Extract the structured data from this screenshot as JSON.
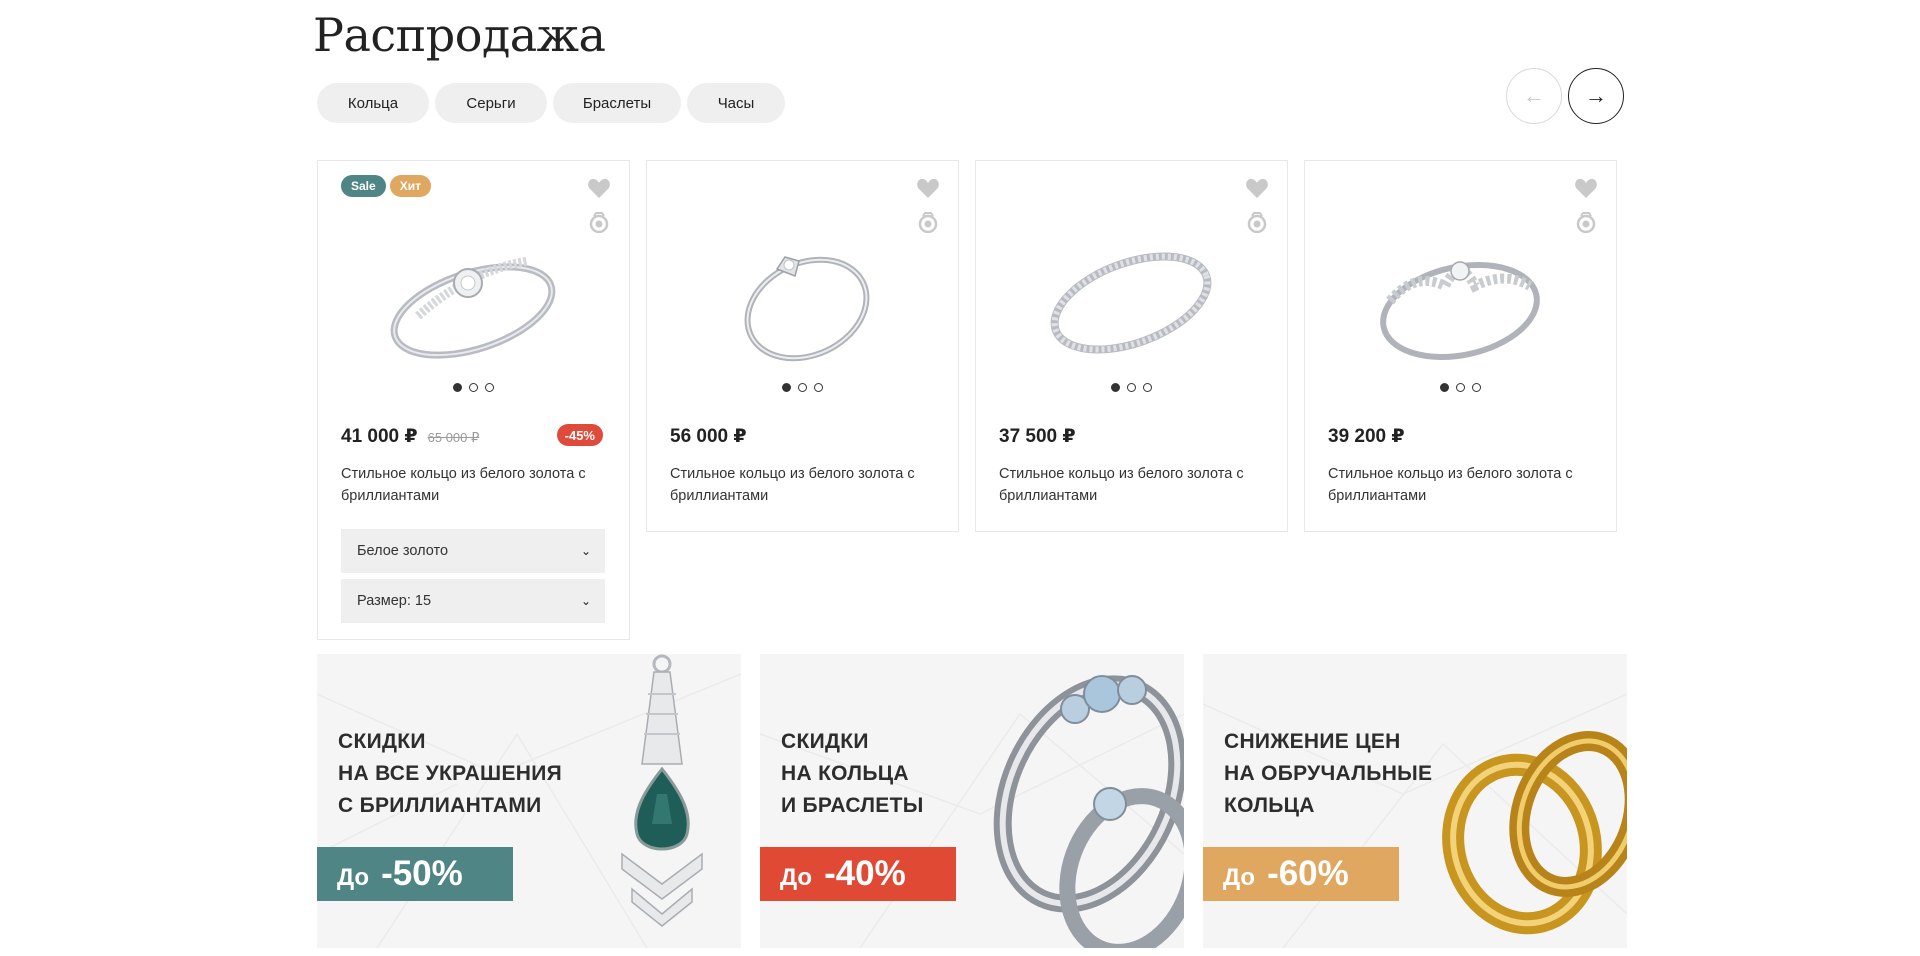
{
  "page": {
    "title": "Распродажа"
  },
  "tabs": [
    {
      "label": "Кольца"
    },
    {
      "label": "Серьги"
    },
    {
      "label": "Браслеты"
    },
    {
      "label": "Часы"
    }
  ],
  "nav": {
    "prev_icon": "←",
    "next_icon": "→"
  },
  "products": [
    {
      "badges": [
        "Sale",
        "Хит"
      ],
      "price": "41 000 ₽",
      "old_price": "65 000 ₽",
      "discount": "-45%",
      "description": "Стильное кольцо из белого золота с бриллиантами",
      "metal_select": "Белое золото",
      "size_select": "Размер: 15",
      "slide_count": 3,
      "active_slide": 1
    },
    {
      "price": "56 000 ₽",
      "description": "Стильное кольцо из белого золота с бриллиантами",
      "slide_count": 3,
      "active_slide": 1
    },
    {
      "price": "37 500 ₽",
      "description": "Стильное кольцо из белого золота с бриллиантами",
      "slide_count": 3,
      "active_slide": 1
    },
    {
      "price": "39 200 ₽",
      "description": "Стильное кольцо из белого золота с бриллиантами",
      "slide_count": 3,
      "active_slide": 1
    }
  ],
  "banners": [
    {
      "line1": "СКИДКИ",
      "line2": "НА ВСЕ УКРАШЕНИЯ",
      "line3": "С БРИЛЛИАНТАМИ",
      "prefix": "До",
      "percent": "-50%",
      "color": "#4f8585"
    },
    {
      "line1": "СКИДКИ",
      "line2": "НА КОЛЬЦА",
      "line3": "И БРАСЛЕТЫ",
      "prefix": "До",
      "percent": "-40%",
      "color": "#e04a35"
    },
    {
      "line1": "СНИЖЕНИЕ ЦЕН",
      "line2": "НА ОБРУЧАЛЬНЫЕ",
      "line3": "КОЛЬЦА",
      "prefix": "До",
      "percent": "-60%",
      "color": "#e0a760"
    }
  ],
  "icons": {
    "favorite": "heart-icon",
    "compare": "compare-icon",
    "select_arrow": "chevron-down-icon"
  }
}
